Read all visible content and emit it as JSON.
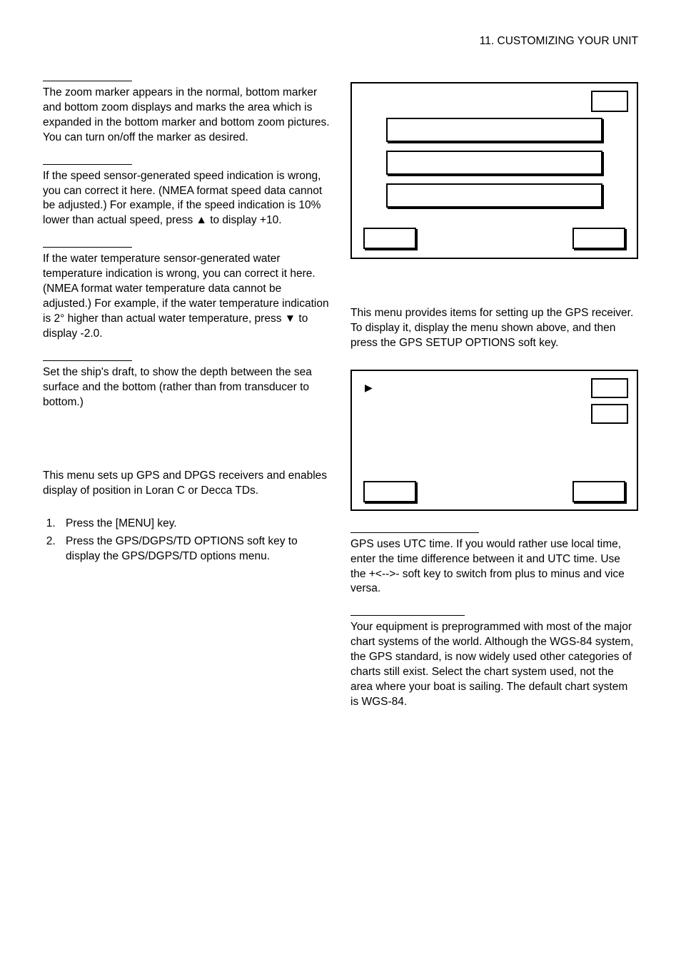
{
  "header": "11. CUSTOMIZING YOUR UNIT",
  "left": {
    "s1": "The zoom marker appears in the normal, bottom marker and bottom zoom displays and marks the area which is expanded in the bottom marker and bottom zoom pictures. You can turn on/off the marker as desired.",
    "s2": "If the speed sensor-generated speed indication is wrong, you can correct it here. (NMEA format speed data cannot be adjusted.) For example, if the speed indication is 10% lower than actual speed, press ▲ to display +10.",
    "s3": "If the water temperature sensor-generated water temperature indication is wrong, you can correct it here. (NMEA format water temperature data cannot be adjusted.) For example, if the water temperature indication is 2° higher than actual water temperature, press ▼ to display -2.0.",
    "s4": "Set the ship's draft, to show the depth between the sea surface and the bottom (rather than from transducer to bottom.)",
    "s5": "This menu sets up GPS and DPGS receivers and enables display of position in Loran C or Decca TDs.",
    "li1": "Press the [MENU] key.",
    "li2": "Press the GPS/DGPS/TD OPTIONS soft key to display the GPS/DGPS/TD options menu."
  },
  "right": {
    "r1": "This menu provides items for setting up the GPS receiver. To display it, display the menu shown above, and then press the GPS SETUP OPTIONS soft key.",
    "r2": "GPS uses UTC time. If you would rather use local time, enter the time difference between it and UTC time. Use the +<-->- soft key to switch from plus to minus and vice versa.",
    "r3": "Your equipment is preprogrammed with most of the major chart systems of the world. Although the WGS-84 system, the GPS standard, is now widely used other categories of charts still exist. Select the chart system used, not the area where your boat is sailing. The default chart system is WGS-84."
  }
}
